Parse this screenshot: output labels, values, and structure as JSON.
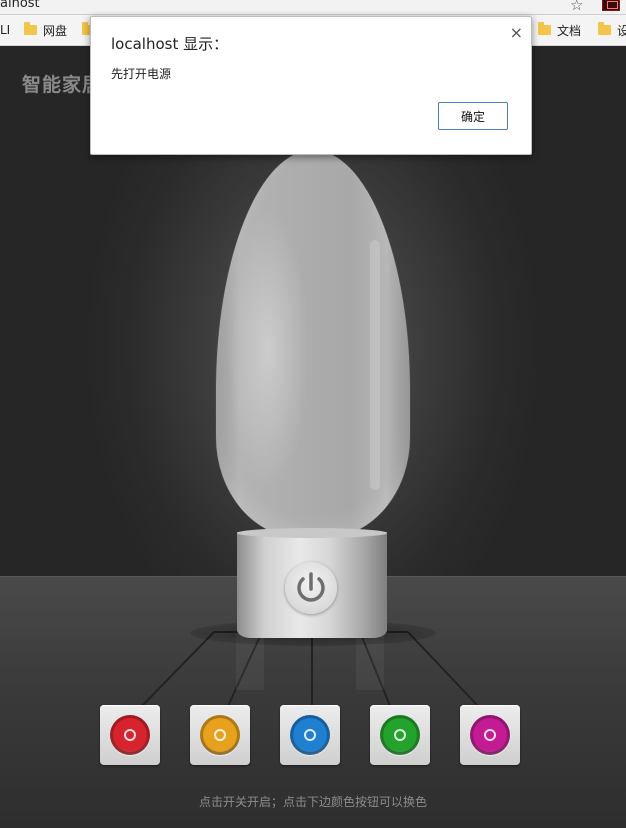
{
  "browser": {
    "url": "alhost",
    "bookmarks": [
      {
        "label": "LI"
      },
      {
        "label": "网盘"
      },
      {
        "label": "文档"
      },
      {
        "label": "设"
      }
    ]
  },
  "page": {
    "title": "智能家居",
    "hint": "点击开关开启；点击下边颜色按钮可以换色"
  },
  "color_buttons": [
    {
      "name": "red",
      "color": "#d7232e"
    },
    {
      "name": "orange",
      "color": "#e7a11d"
    },
    {
      "name": "blue",
      "color": "#1f7fd0"
    },
    {
      "name": "green",
      "color": "#23a32b"
    },
    {
      "name": "magenta",
      "color": "#c21b94"
    }
  ],
  "dialog": {
    "title": "localhost 显示：",
    "message": "先打开电源",
    "ok_label": "确定",
    "close_glyph": "×"
  }
}
